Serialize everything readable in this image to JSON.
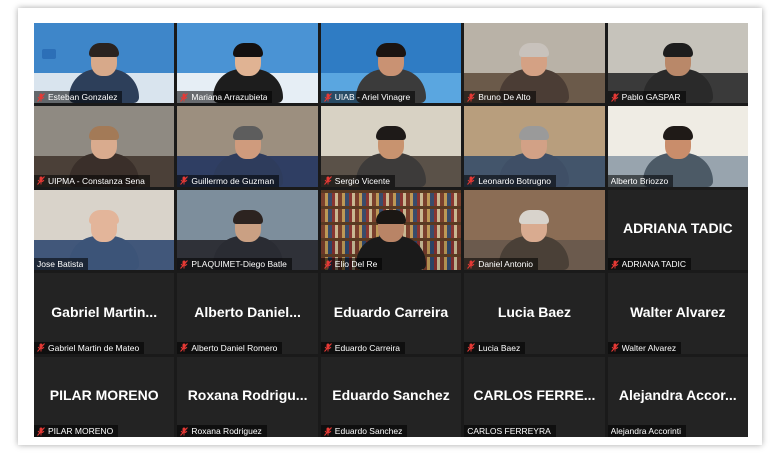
{
  "colors": {
    "tile_bg": "#232323",
    "active_speaker_border": "#c8e04a",
    "muted_mic": "#e53935"
  },
  "participants": [
    {
      "name": "Esteban Gonzalez",
      "video": true,
      "muted": true,
      "scene": "blue-office"
    },
    {
      "name": "Mariana Arrazubieta",
      "video": true,
      "muted": true,
      "scene": "blue-office-woman"
    },
    {
      "name": "UIAB - Ariel Vinagre",
      "video": true,
      "muted": true,
      "scene": "blue-screen"
    },
    {
      "name": "Bruno De Alto",
      "video": true,
      "muted": true,
      "scene": "home-shelf"
    },
    {
      "name": "Pablo GASPAR",
      "video": true,
      "muted": true,
      "scene": "dark-office"
    },
    {
      "name": "UIPMA - Constanza Sena",
      "video": true,
      "muted": true,
      "scene": "window-woman"
    },
    {
      "name": "Guillermo de Guzman",
      "video": true,
      "muted": true,
      "scene": "room-blue"
    },
    {
      "name": "Sergio Vicente",
      "video": true,
      "muted": true,
      "scene": "room-light"
    },
    {
      "name": "Leonardo Botrugno",
      "video": true,
      "muted": true,
      "scene": "room-posters"
    },
    {
      "name": "Alberto Briozzo",
      "video": true,
      "muted": false,
      "active": true,
      "scene": "bright-office"
    },
    {
      "name": "Jose Batista",
      "video": true,
      "muted": false,
      "scene": "bald-man"
    },
    {
      "name": "PLAQUIMET-Diego Batle",
      "video": true,
      "muted": true,
      "scene": "headset"
    },
    {
      "name": "Elio Del Re",
      "video": true,
      "muted": true,
      "scene": "bookshelf"
    },
    {
      "name": "Daniel Antonio",
      "video": true,
      "muted": true,
      "scene": "old-man"
    },
    {
      "name": "ADRIANA TADIC",
      "video": false,
      "muted": true,
      "display": "ADRIANA TADIC"
    },
    {
      "name": "Gabriel Martin de Mateo",
      "video": false,
      "muted": true,
      "display": "Gabriel Martin..."
    },
    {
      "name": "Alberto Daniel Romero",
      "video": false,
      "muted": true,
      "display": "Alberto Daniel..."
    },
    {
      "name": "Eduardo Carreira",
      "video": false,
      "muted": true,
      "display": "Eduardo Carreira"
    },
    {
      "name": "Lucia Baez",
      "video": false,
      "muted": true,
      "display": "Lucia Baez"
    },
    {
      "name": "Walter Alvarez",
      "video": false,
      "muted": true,
      "display": "Walter Alvarez"
    },
    {
      "name": "PILAR MORENO",
      "video": false,
      "muted": true,
      "display": "PILAR MORENO"
    },
    {
      "name": "Roxana Rodriguez",
      "video": false,
      "muted": true,
      "display": "Roxana Rodrigu..."
    },
    {
      "name": "Eduardo Sanchez",
      "video": false,
      "muted": true,
      "display": "Eduardo Sanchez"
    },
    {
      "name": "CARLOS FERREYRA",
      "video": false,
      "muted": false,
      "display": "CARLOS FERRE..."
    },
    {
      "name": "Alejandra Accorinti",
      "video": false,
      "muted": false,
      "display": "Alejandra Accor..."
    }
  ]
}
